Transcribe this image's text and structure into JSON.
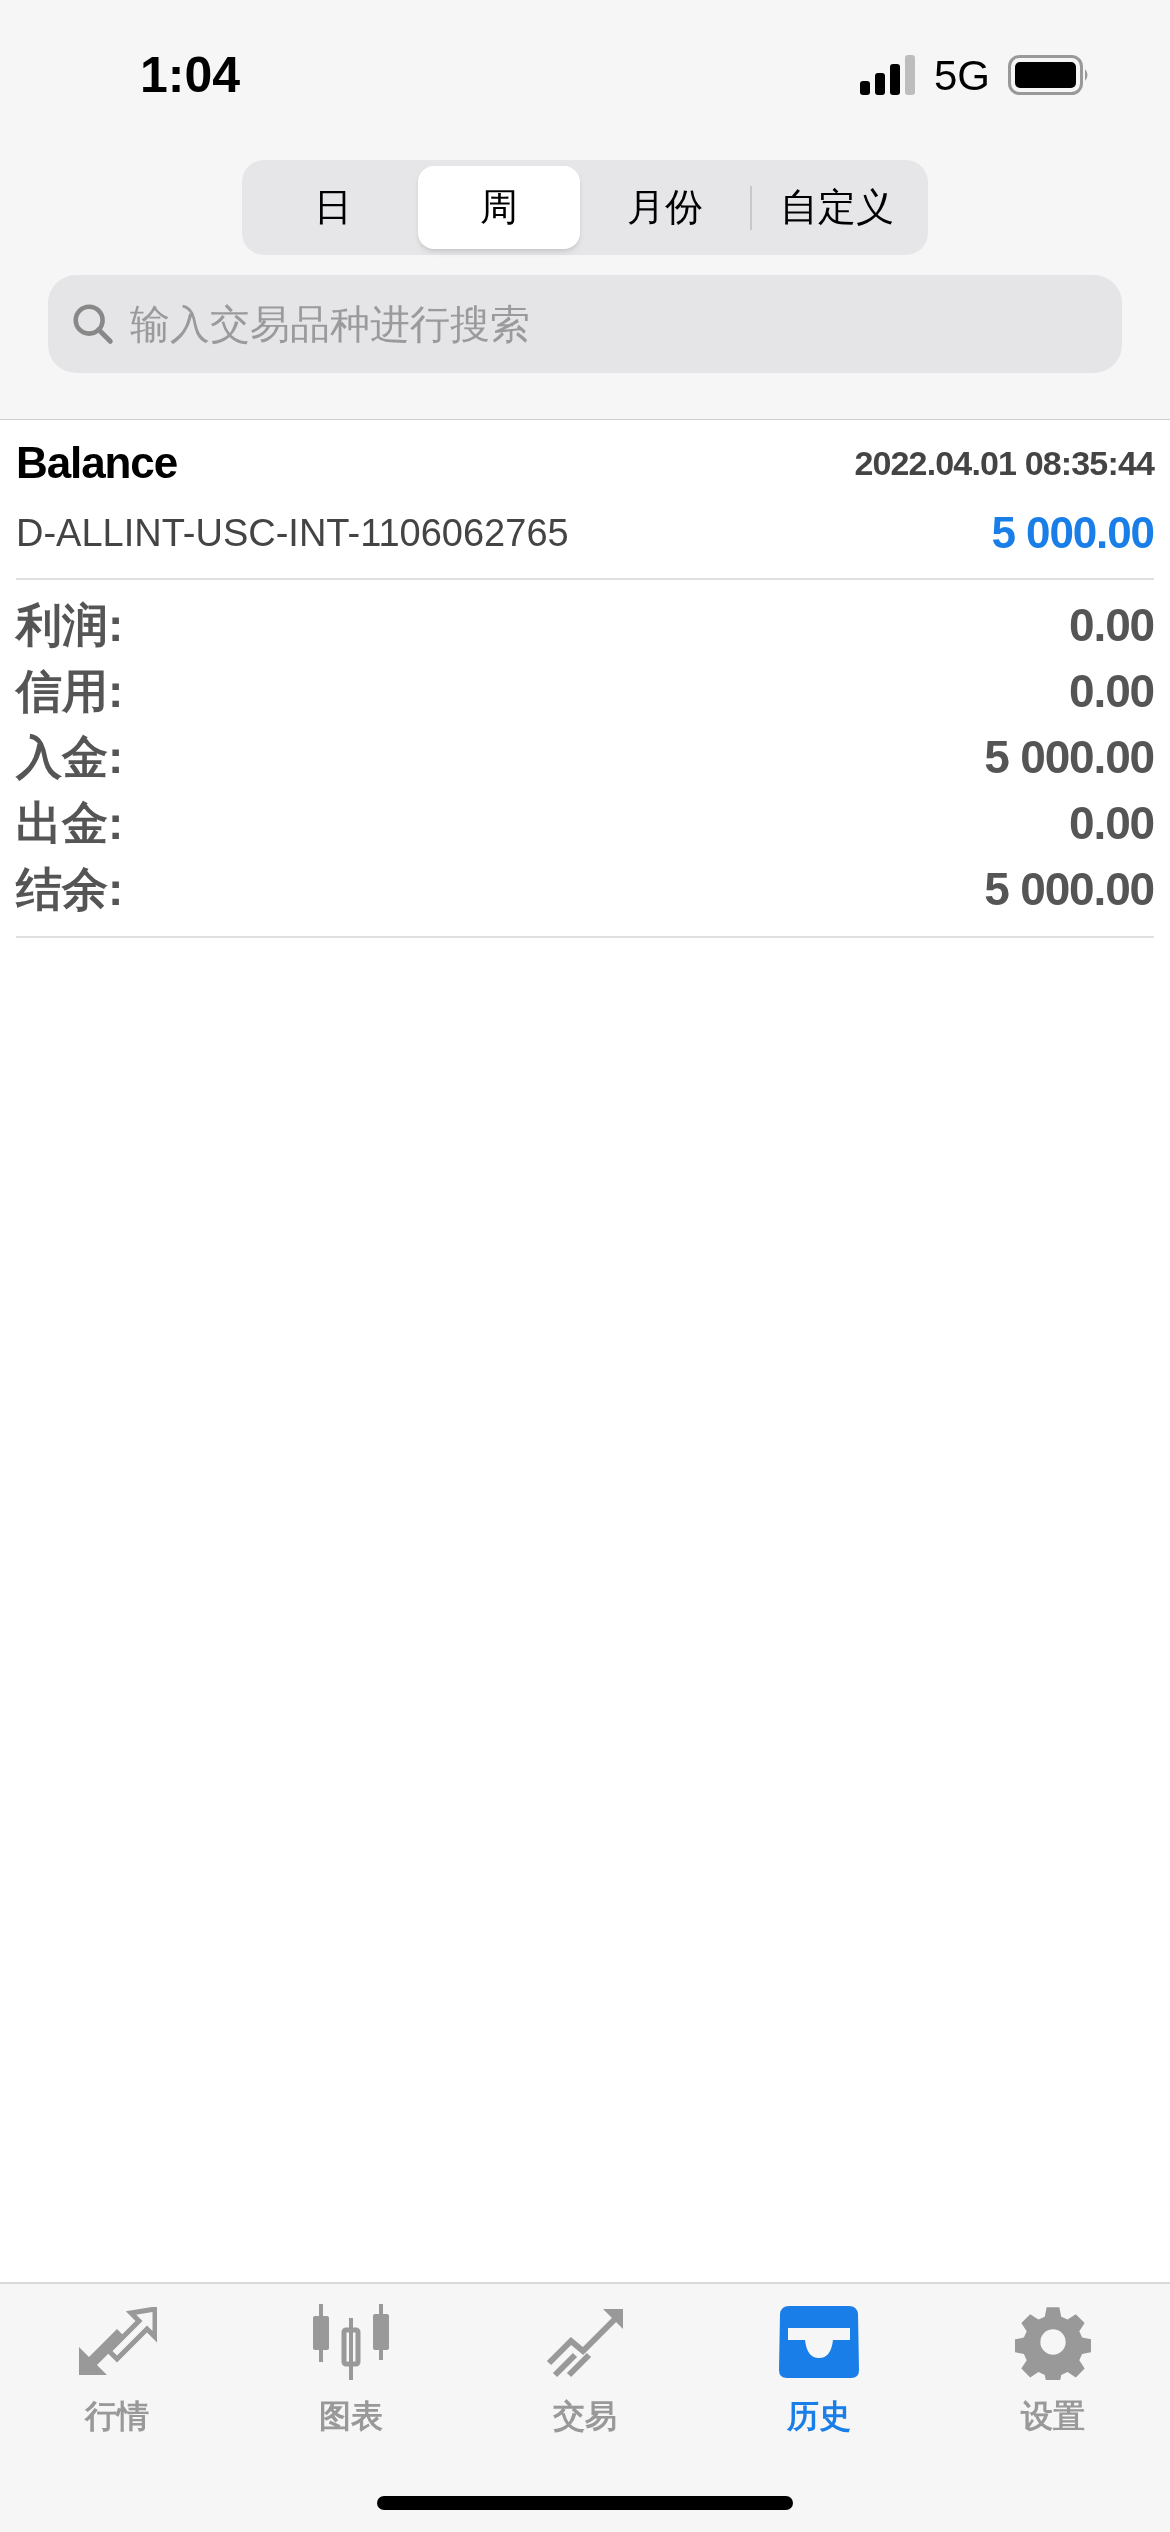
{
  "status_bar": {
    "time": "1:04",
    "network": "5G"
  },
  "period_tabs": [
    {
      "label": "日",
      "selected": false
    },
    {
      "label": "周",
      "selected": true
    },
    {
      "label": "月份",
      "selected": false
    },
    {
      "label": "自定义",
      "selected": false
    }
  ],
  "search": {
    "placeholder": "输入交易品种进行搜索"
  },
  "deal": {
    "type": "Balance",
    "time": "2022.04.01 08:35:44",
    "account": "D-ALLINT-USC-INT-1106062765",
    "amount": "5 000.00"
  },
  "summary": [
    {
      "label": "利润:",
      "value": "0.00"
    },
    {
      "label": "信用:",
      "value": "0.00"
    },
    {
      "label": "入金:",
      "value": "5 000.00"
    },
    {
      "label": "出金:",
      "value": "0.00"
    },
    {
      "label": "结余:",
      "value": "5 000.00"
    }
  ],
  "tab_bar": [
    {
      "kind": "quotes",
      "label": "行情",
      "selected": false
    },
    {
      "kind": "chart",
      "label": "图表",
      "selected": false
    },
    {
      "kind": "trade",
      "label": "交易",
      "selected": false
    },
    {
      "kind": "history",
      "label": "历史",
      "selected": true
    },
    {
      "kind": "settings",
      "label": "设置",
      "selected": false
    }
  ]
}
